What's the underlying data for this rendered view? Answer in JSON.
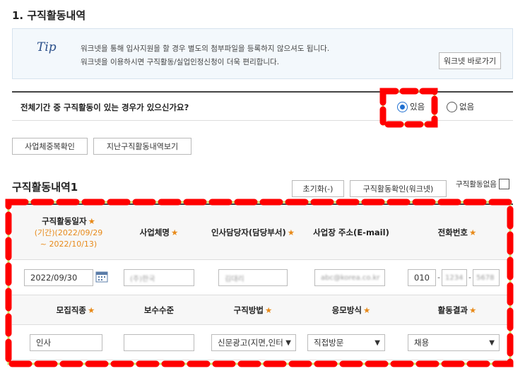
{
  "section_title": "1. 구직활동내역",
  "tip": {
    "label": "Tip",
    "line1": "워크넷을 통해 입사지원을 할 경우 별도의 첨부파일을 등록하지 않으셔도 됩니다.",
    "line2": "워크넷을 이용하시면 구직활동/실업인정신청이 더욱 편리합니다.",
    "button": "워크넷 바로가기"
  },
  "question": {
    "text": "전체기간 중 구직활동이 있는 경우가 있으신가요?",
    "yes": "있음",
    "no": "없음",
    "selected": "yes"
  },
  "buttons": {
    "dup_check": "사업체중복확인",
    "past_view": "지난구직활동내역보기",
    "reset": "초기화(-)",
    "confirm": "구직활동확인(워크넷)",
    "no_activity": "구직활동없음"
  },
  "list_title": "구직활동내역1",
  "table": {
    "headers1": {
      "date": "구직활동일자",
      "date_period": "(기간)(2022/09/29",
      "date_period2": "~ 2022/10/13)",
      "company": "사업체명",
      "hr": "인사담당자(담당부서)",
      "address": "사업장 주소(E-mail)",
      "phone": "전화번호"
    },
    "star": "★",
    "row1": {
      "date": "2022/09/30",
      "company": "(주)한국",
      "hr": "김대리",
      "address": "abc@korea.co.kr",
      "phone1": "010",
      "phone2": "1234",
      "phone3": "5678"
    },
    "headers2": {
      "job": "모집직종",
      "salary": "보수수준",
      "method": "구직방법",
      "apply": "응모방식",
      "result": "활동결과"
    },
    "row2": {
      "job": "인사",
      "salary": "",
      "method": "신문광고(지면,인터",
      "apply": "직접방문",
      "result": "채용"
    }
  },
  "colors": {
    "highlight_fill": "#ff0000",
    "highlight_border": "#c8e86a",
    "star": "#e88a1a",
    "radio_on": "#1f6fd1"
  }
}
